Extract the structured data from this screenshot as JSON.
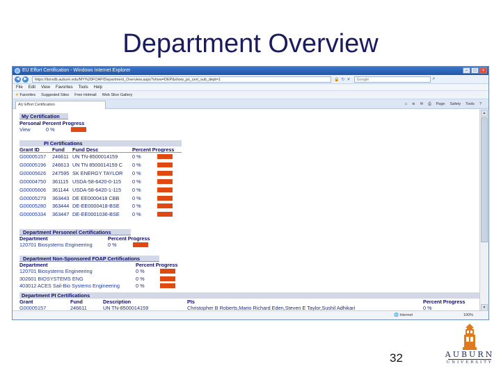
{
  "slide": {
    "title": "Department Overview",
    "page_number": "32"
  },
  "browser": {
    "window_title": "EU Effort Certification - Windows Internet Explorer",
    "url": "https://itsrsdb.auburn.edu/MY%20FOAP/Department_Overview.aspx?show=DEP&show_ps_cert_sub_dept=1",
    "search_placeholder": "Google",
    "menu": [
      "File",
      "Edit",
      "View",
      "Favorites",
      "Tools",
      "Help"
    ],
    "favorites": [
      "Favorites",
      "Suggested Sites",
      "Free Hotmail",
      "Web Slice Gallery"
    ],
    "tab_label": "AU Effort Certification",
    "commands": [
      "Page",
      "Safety",
      "Tools"
    ],
    "status_zone": "Internet",
    "status_zoom": "100%"
  },
  "colors": {
    "bar": "#e04a12",
    "title": "#1a1a5e",
    "link": "#1a3aa8"
  },
  "my_certification": {
    "header": "My Certification",
    "col_headers": [
      "Personal Percent Progress"
    ],
    "rows": [
      {
        "link": "View",
        "percent": "0 %",
        "progress": 0.0
      }
    ]
  },
  "pi_certifications": {
    "header": "PI Certifications",
    "col_headers": [
      "Grant ID",
      "Fund",
      "Fund Desc",
      "Percent Progress"
    ],
    "rows": [
      {
        "grant": "G00005157",
        "fund": "246611",
        "desc": "UN TN-8500014159",
        "percent": "0 %"
      },
      {
        "grant": "G00005196",
        "fund": "246613",
        "desc": "UN TN 8500014159 C",
        "percent": "0 %"
      },
      {
        "grant": "G00005626",
        "fund": "247595",
        "desc": "SK ENERGY TAYLOR",
        "percent": "0 %"
      },
      {
        "grant": "G00004750",
        "fund": "361115",
        "desc": "USDA-58-6420-0-115",
        "percent": "0 %"
      },
      {
        "grant": "G00005606",
        "fund": "361144",
        "desc": "USDA-58-6420-1-115",
        "percent": "0 %"
      },
      {
        "grant": "G00005279",
        "fund": "363443",
        "desc": "DE EE0000418 CBB",
        "percent": "0 %"
      },
      {
        "grant": "G00005280",
        "fund": "363444",
        "desc": "DE-EE0000418-BSE",
        "percent": "0 %"
      },
      {
        "grant": "G00005334",
        "fund": "363447",
        "desc": "DE-EE0001036-BSE",
        "percent": "0 %"
      }
    ]
  },
  "dept_personnel": {
    "header": "Department Personnel Certifications",
    "col_headers": [
      "Department",
      "Percent Progress"
    ],
    "rows": [
      {
        "dept": "120701 Biosystems Engineering",
        "percent": "0 %"
      }
    ]
  },
  "dept_non_sponsored": {
    "header": "Department Non-Sponsored FOAP Certifications",
    "col_headers": [
      "Department",
      "Percent Progress"
    ],
    "rows": [
      {
        "dept": "120701 Biosystems Engineering",
        "percent": "0 %"
      },
      {
        "dept": "302601 BIOSYSTEMS ENG",
        "percent": "0 %"
      },
      {
        "dept": "403012 ACES Sail-Bio Systems Engineering",
        "percent": "0 %"
      }
    ]
  },
  "dept_pi": {
    "header": "Department PI Certifications",
    "col_headers": [
      "Grant",
      "Fund",
      "Description",
      "PIs",
      "Percent Progress"
    ],
    "rows": [
      {
        "grant": "G00005157",
        "fund": "246611",
        "desc": "UN TN-8500014159",
        "pis": "Christopher B Roberts,Mario Richard Eden,Steven E Taylor,Sushil Adhikari",
        "percent": "0 %"
      }
    ]
  },
  "logo": {
    "name": "AUBURN",
    "sub": "UNIVERSITY"
  }
}
